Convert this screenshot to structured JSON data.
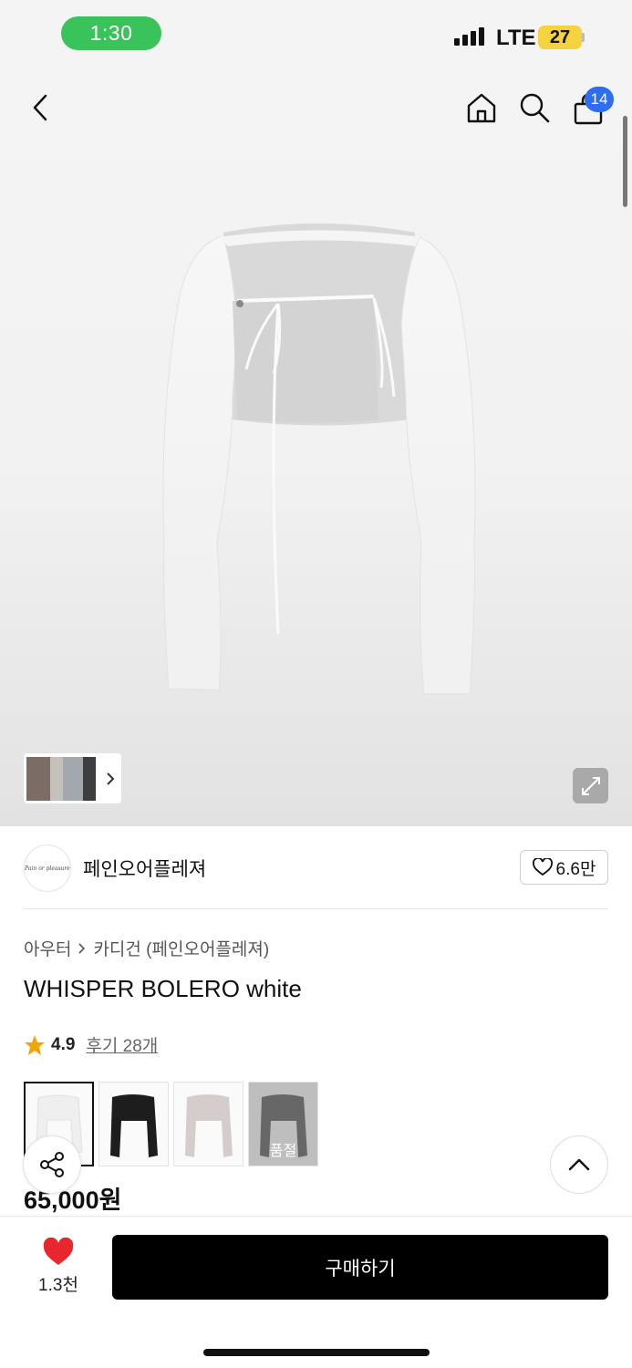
{
  "status_bar": {
    "time": "1:30",
    "network": "LTE",
    "battery": "27"
  },
  "nav": {
    "cart_count": "14"
  },
  "brand": {
    "name": "페인오어플레져",
    "logo_text": "Pain or pleasure",
    "favorites": "6.6만"
  },
  "breadcrumb": {
    "category": "아우터",
    "subcategory": "카디건 (페인오어플레져)"
  },
  "product": {
    "title": "WHISPER BOLERO white",
    "rating": "4.9",
    "reviews": "후기 28개",
    "price": "65,000원",
    "rating_value": 4.9
  },
  "variants": [
    {
      "color": "white",
      "sold_out": false,
      "selected": true
    },
    {
      "color": "black",
      "sold_out": false,
      "selected": false
    },
    {
      "color": "pink-grey",
      "sold_out": false,
      "selected": false
    },
    {
      "color": "black",
      "sold_out": true,
      "selected": false,
      "label": "품절"
    }
  ],
  "bottom": {
    "like_count": "1.3천",
    "buy_label": "구매하기"
  },
  "colors": {
    "accent_heart": "#e8262d",
    "badge": "#2f6df0",
    "status_pill": "#3ac35b",
    "star": "#f0a500"
  }
}
